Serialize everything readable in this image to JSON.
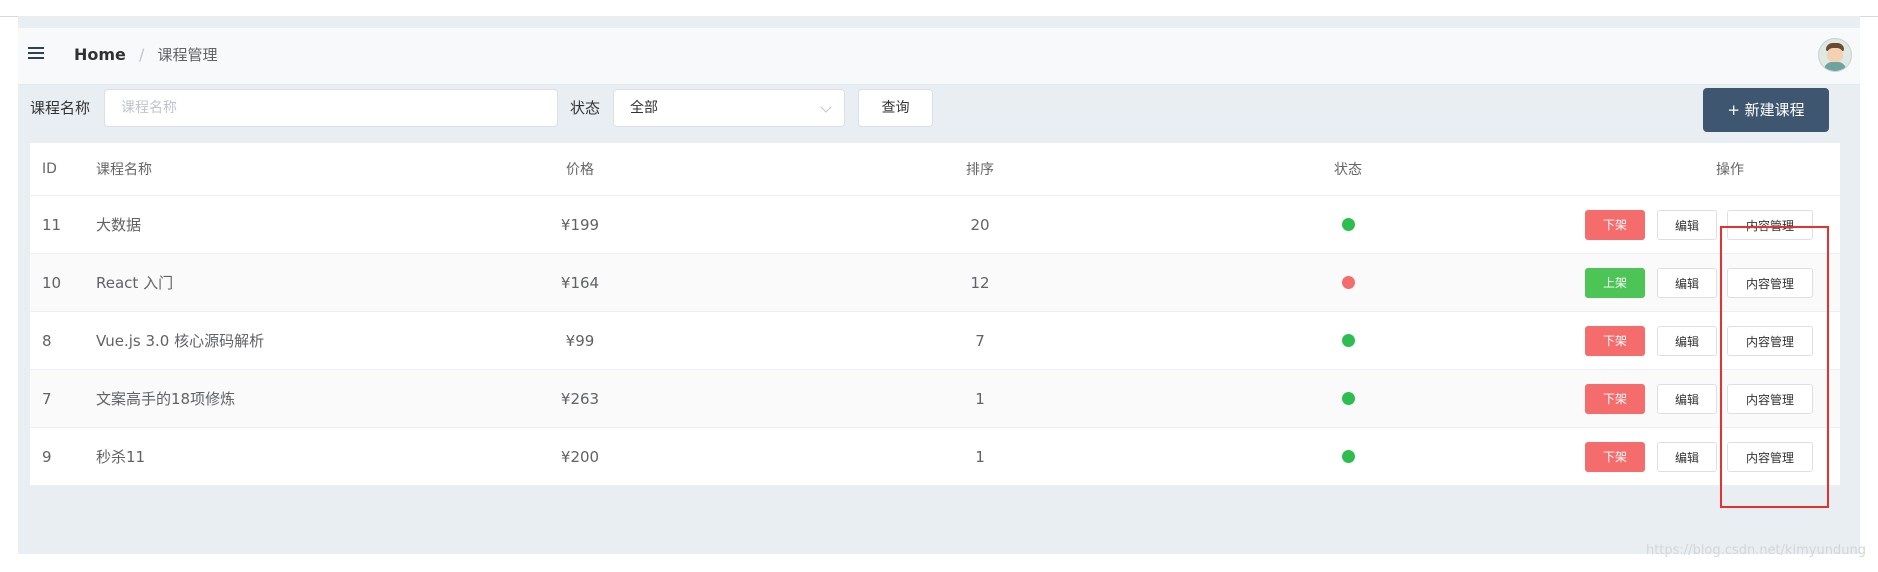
{
  "header": {
    "home_label": "Home",
    "separator": "/",
    "current_page": "课程管理"
  },
  "filters": {
    "name_label": "课程名称",
    "name_placeholder": "课程名称",
    "status_label": "状态",
    "status_selected": "全部",
    "query_label": "查询",
    "new_label": "+ 新建课程"
  },
  "table": {
    "columns": [
      "ID",
      "课程名称",
      "价格",
      "排序",
      "状态",
      "操作"
    ],
    "rows": [
      {
        "id": "11",
        "name": "大数据",
        "price": "¥199",
        "order": "20",
        "status_color": "#2ebd4f",
        "toggle": "下架",
        "toggle_color": "#f56c6c",
        "edit": "编辑",
        "content": "内容管理"
      },
      {
        "id": "10",
        "name": "React 入门",
        "price": "¥164",
        "order": "12",
        "status_color": "#f56c6c",
        "toggle": "上架",
        "toggle_color": "#4cc456",
        "edit": "编辑",
        "content": "内容管理"
      },
      {
        "id": "8",
        "name": "Vue.js 3.0 核心源码解析",
        "price": "¥99",
        "order": "7",
        "status_color": "#2ebd4f",
        "toggle": "下架",
        "toggle_color": "#f56c6c",
        "edit": "编辑",
        "content": "内容管理"
      },
      {
        "id": "7",
        "name": "文案高手的18项修炼",
        "price": "¥263",
        "order": "1",
        "status_color": "#2ebd4f",
        "toggle": "下架",
        "toggle_color": "#f56c6c",
        "edit": "编辑",
        "content": "内容管理"
      },
      {
        "id": "9",
        "name": "秒杀11",
        "price": "¥200",
        "order": "1",
        "status_color": "#2ebd4f",
        "toggle": "下架",
        "toggle_color": "#f56c6c",
        "edit": "编辑",
        "content": "内容管理"
      }
    ]
  },
  "icons": {
    "menu": "menu-icon",
    "avatar": "user-avatar"
  },
  "watermark": "https://blog.csdn.net/kimyundung"
}
